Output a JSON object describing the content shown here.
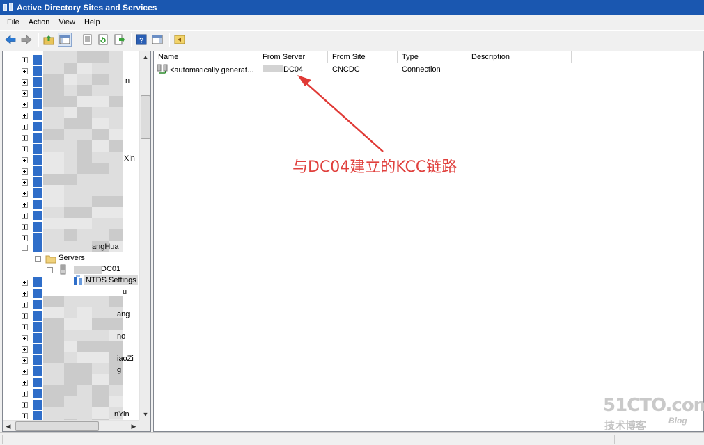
{
  "window": {
    "title": "Active Directory Sites and Services"
  },
  "menu": [
    "File",
    "Action",
    "View",
    "Help"
  ],
  "toolbar_icons": [
    "back-icon",
    "forward-icon",
    "up-folder-icon",
    "show-hide-console-tree-icon",
    "properties-icon",
    "refresh-icon",
    "export-list-icon",
    "help-icon",
    "show-hide-action-pane-icon",
    "run-icon"
  ],
  "tree": {
    "fragments": [
      {
        "text": "n"
      },
      {
        "text": "Xin"
      },
      {
        "text": "angHua"
      },
      {
        "text": "Servers"
      },
      {
        "text": "DC01"
      },
      {
        "text": "NTDS Settings"
      },
      {
        "text": "u"
      },
      {
        "text": "ang"
      },
      {
        "text": "no"
      },
      {
        "text": "iaoZi"
      },
      {
        "text": "g"
      },
      {
        "text": "nYin"
      }
    ]
  },
  "list": {
    "columns": [
      "Name",
      "From Server",
      "From Site",
      "Type",
      "Description"
    ],
    "rows": [
      {
        "name": "<automatically generat...",
        "from_server": "DC04",
        "from_site": "CNCDC",
        "type": "Connection",
        "description": ""
      }
    ]
  },
  "annotation": {
    "text": "与DC04建立的KCC链路",
    "color": "#e0403d"
  },
  "watermark": {
    "main": "51CTO.com",
    "sub": "技术博客",
    "blog": "Blog"
  }
}
